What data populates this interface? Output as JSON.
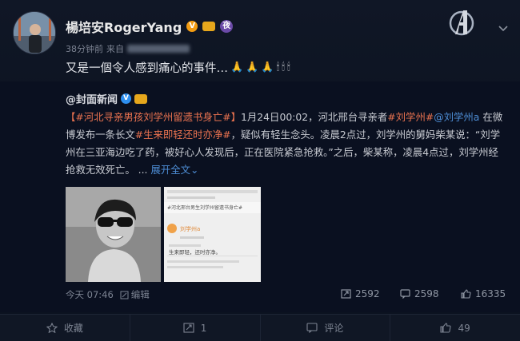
{
  "author": {
    "name": "楊培安RogerYang",
    "v_badge": "V",
    "night_badge": "夜"
  },
  "meta": {
    "time": "38分钟前",
    "source_prefix": "来自"
  },
  "post": {
    "text": "又是一個令人感到痛心的事件…",
    "emojis": [
      "🙏",
      "🙏",
      "🙏",
      "🕯",
      "🕯",
      "🕯"
    ]
  },
  "repost": {
    "author": "@封面新闻",
    "topic1": "【#河北寻亲男孩刘学州留遗书身亡#】",
    "seg1": "1月24日00:02，河北邢台寻亲者",
    "topic2": "#刘学州#",
    "mention": "@刘学州a",
    "seg2": " 在微博发布一条长文",
    "topic3": "#生来即轻还时亦净#",
    "seg3": "，疑似有轻生念头。凌晨2点过，刘学州的舅妈柴某说：“刘学州在三亚海边吃了药，被好心人发现后，正在医院紧急抢救。”之后，柴某称，凌晨4点过，刘学州经抢救无效死亡。 ...",
    "expand": "展开全文",
    "expand_arrow": "⌄",
    "time": "今天 07:46",
    "edit_label": "编辑",
    "img2_line1": "#河北邢台男生刘学州留遗书身亡#",
    "img2_name": "刘学州a",
    "img2_line2": "生来即轻，还时亦净。",
    "stats": {
      "reposts": "2592",
      "comments": "2598",
      "likes": "16335"
    }
  },
  "toolbar": {
    "favorite": "收藏",
    "repost_count": "1",
    "comment": "评论",
    "like_count": "49"
  },
  "colors": {
    "background": "#0d1322",
    "topic_link": "#eb7350",
    "mention_link": "#4e8ed6",
    "verified_blue": "#2d8ff0",
    "verified_orange": "#f39c12"
  },
  "icons": [
    "avatar",
    "avengers-logo-icon",
    "chevron-down-icon",
    "verified-icon",
    "vip-crown-icon",
    "night-badge-icon",
    "edit-icon",
    "repost-icon",
    "comment-icon",
    "like-icon",
    "favorite-icon"
  ]
}
